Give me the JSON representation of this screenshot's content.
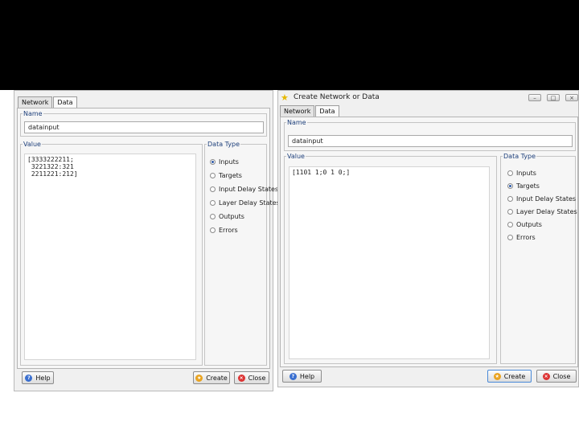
{
  "dialogs": {
    "left": {
      "tabs": [
        "Network",
        "Data"
      ],
      "name_label": "Name",
      "name_value": "datainput",
      "value_label": "Value",
      "value_text": "[3333222211;\n 3221322:321\n 2211221:212]",
      "type_label": "Data Type",
      "types": [
        "Inputs",
        "Targets",
        "Input Delay States",
        "Layer Delay States",
        "Outputs",
        "Errors"
      ],
      "selected_type": "Inputs",
      "help_label": "Help",
      "create_label": "Create",
      "close_label": "Close"
    },
    "right": {
      "title": "Create Network or Data",
      "tabs": [
        "Network",
        "Data"
      ],
      "name_label": "Name",
      "name_value": "datainput",
      "value_label": "Value",
      "value_text": "[1101 1;0 1 0;]",
      "type_label": "Data Type",
      "types": [
        "Inputs",
        "Targets",
        "Input Delay States",
        "Layer Delay States",
        "Outputs",
        "Errors"
      ],
      "selected_type": "Targets",
      "help_label": "Help",
      "create_label": "Create",
      "close_label": "Close"
    }
  },
  "icons": {
    "title": "star-icon",
    "help": "help-icon",
    "create": "create-icon",
    "close": "close-icon"
  }
}
